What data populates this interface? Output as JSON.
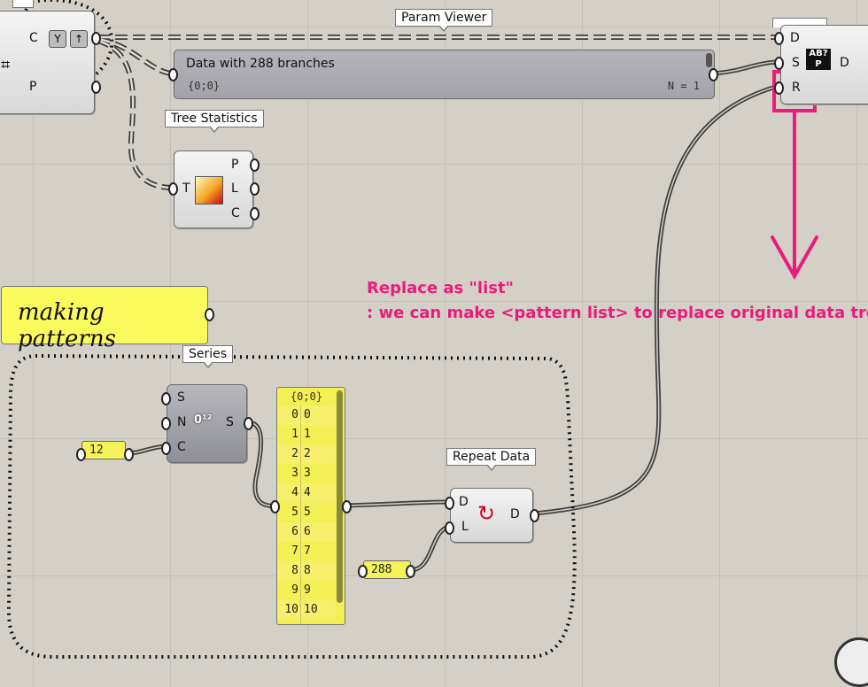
{
  "canvas": {
    "accent": "#ec1b7b",
    "wire": "#4a4a4a",
    "panel_yellow": "#f4ef52"
  },
  "top_left_component": {
    "inputs": [
      "C",
      "P"
    ]
  },
  "param_viewer": {
    "tag": "Param Viewer",
    "title": "Data with 288 branches",
    "path": "{0;0}",
    "count": "N = 1"
  },
  "tree_statistics": {
    "tag": "Tree Statistics",
    "input": "T",
    "outputs": [
      "P",
      "L",
      "C"
    ],
    "icon": "tree-statistics-icon"
  },
  "replace_paths": {
    "inputs": [
      "D",
      "S",
      "R"
    ],
    "output": "D",
    "icon": "replace-paths-icon"
  },
  "scribble": {
    "text": "making patterns"
  },
  "annotation": {
    "line1": "Replace as \"list\"",
    "line2": ": we can make <pattern list> to replace original data tree"
  },
  "series": {
    "tag": "Series",
    "inputs": [
      "S",
      "N",
      "C"
    ],
    "output": "S",
    "icon": "series-icon"
  },
  "number_c": {
    "value": "12"
  },
  "panel": {
    "header": "{0;0}",
    "rows": [
      {
        "i": "0",
        "v": "0"
      },
      {
        "i": "1",
        "v": "1"
      },
      {
        "i": "2",
        "v": "2"
      },
      {
        "i": "3",
        "v": "3"
      },
      {
        "i": "4",
        "v": "4"
      },
      {
        "i": "5",
        "v": "5"
      },
      {
        "i": "6",
        "v": "6"
      },
      {
        "i": "7",
        "v": "7"
      },
      {
        "i": "8",
        "v": "8"
      },
      {
        "i": "9",
        "v": "9"
      },
      {
        "i": "10",
        "v": "10"
      }
    ]
  },
  "repeat_data": {
    "tag": "Repeat Data",
    "inputs": [
      "D",
      "L"
    ],
    "output": "D",
    "icon": "repeat-data-icon"
  },
  "number_l": {
    "value": "288"
  }
}
